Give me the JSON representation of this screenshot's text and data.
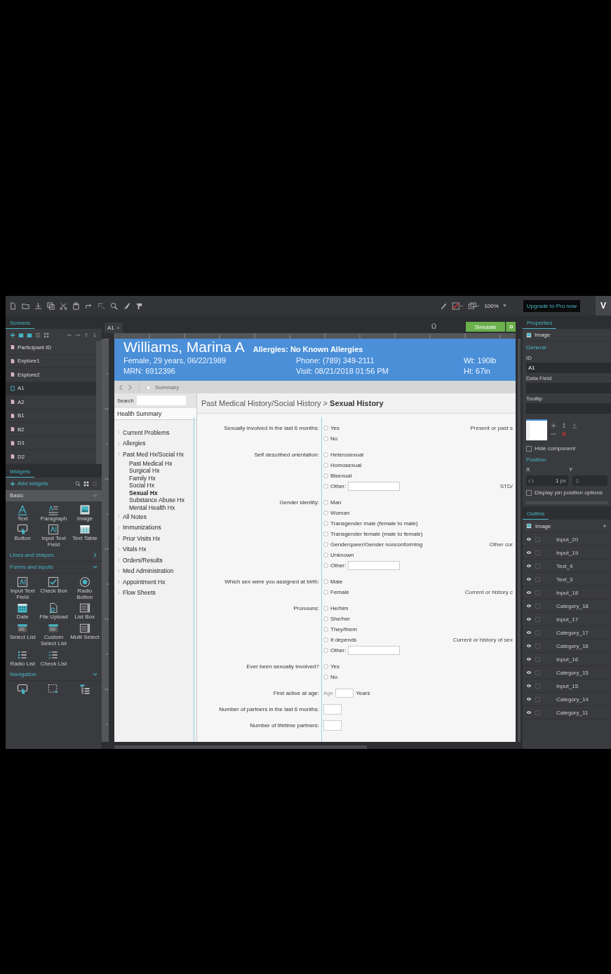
{
  "toolbar": {
    "zoom": "100%",
    "upgrade": "Upgrade to Pro now",
    "account": "V"
  },
  "screens": {
    "tab": "Screens",
    "items": [
      {
        "name": "Participant ID",
        "selected": false
      },
      {
        "name": "Explore1",
        "selected": false
      },
      {
        "name": "Explore2",
        "selected": false
      },
      {
        "name": "A1",
        "selected": true
      },
      {
        "name": "A2",
        "selected": false
      },
      {
        "name": "B1",
        "selected": false
      },
      {
        "name": "B2",
        "selected": false
      },
      {
        "name": "D1",
        "selected": false
      },
      {
        "name": "D2",
        "selected": false
      }
    ]
  },
  "widgets": {
    "tab": "Widgets",
    "add": "Add widgets",
    "sections": [
      {
        "title": "Basic",
        "kind": "bar",
        "expanded": true,
        "items": [
          {
            "label": "Text",
            "kind": "text"
          },
          {
            "label": "Paragraph",
            "kind": "paragraph"
          },
          {
            "label": "Image",
            "kind": "image"
          },
          {
            "label": "Button",
            "kind": "button"
          },
          {
            "label": "Input Text Field",
            "kind": "input"
          },
          {
            "label": "Text Table",
            "kind": "table"
          }
        ]
      },
      {
        "title": "Lines and shapes",
        "kind": "link",
        "expanded": false
      },
      {
        "title": "Forms and inputs",
        "kind": "link",
        "expanded": true,
        "items": [
          {
            "label": "Input Text Field",
            "kind": "input"
          },
          {
            "label": "Check Box",
            "kind": "checkbox"
          },
          {
            "label": "Radio Button",
            "kind": "radio"
          },
          {
            "label": "Date",
            "kind": "date"
          },
          {
            "label": "File Upload",
            "kind": "upload"
          },
          {
            "label": "List Box",
            "kind": "listbox"
          },
          {
            "label": "Select List",
            "kind": "select"
          },
          {
            "label": "Custom Select List",
            "kind": "select"
          },
          {
            "label": "Multi Select",
            "kind": "listbox"
          },
          {
            "label": "Radio List",
            "kind": "radiolist"
          },
          {
            "label": "Check List",
            "kind": "checklist"
          }
        ]
      },
      {
        "title": "Navigation",
        "kind": "link",
        "expanded": true,
        "items": [
          {
            "kind": "button"
          },
          {
            "kind": "region"
          },
          {
            "kind": "tree"
          }
        ]
      }
    ]
  },
  "canvas": {
    "tab": "A1",
    "simulate": "Simulate"
  },
  "page": {
    "header": {
      "name": "Williams, Marina A",
      "allergies": "Allergies: No Known Allergies",
      "demographics": "Female, 29 years, 06/22/1989",
      "phone": "Phone: (789) 349-2111",
      "weight": "Wt: 190lb",
      "mrn": "MRN: 6912396",
      "visit": "Visit: 08/21/2018 01:56 PM",
      "height": "Ht: 67in"
    },
    "breadcrumb": "Summary",
    "search": "Search",
    "summary": "Health Summary",
    "nav": [
      {
        "label": "Current Problems",
        "expanded": false
      },
      {
        "label": "Allergies",
        "expanded": false
      },
      {
        "label": "Past Med Hx/Social Hx",
        "expanded": true,
        "children": [
          {
            "label": "Past Medical Hx",
            "selected": false
          },
          {
            "label": "Surgical Hx",
            "selected": false
          },
          {
            "label": "Family Hx",
            "selected": false
          },
          {
            "label": "Social Hx",
            "selected": false
          },
          {
            "label": "Sexual Hx",
            "selected": true
          },
          {
            "label": "Substance Abuse Hx",
            "selected": false
          },
          {
            "label": "Mental Health Hx",
            "selected": false
          }
        ]
      },
      {
        "label": "All Notes",
        "expanded": false
      },
      {
        "label": "Immunizations",
        "expanded": false
      },
      {
        "label": "Prior Visits Hx",
        "expanded": false
      },
      {
        "label": "Vitals Hx",
        "expanded": false
      },
      {
        "label": "Orders/Results",
        "expanded": false
      },
      {
        "label": "Med Administration",
        "expanded": false
      },
      {
        "label": "Appointment Hx",
        "expanded": false
      },
      {
        "label": "Flow Sheets",
        "expanded": false
      }
    ],
    "title": "Past Medical History/Social History > **Sexual History**",
    "form": [
      {
        "kind": "radio",
        "label": "Sexually involved in the last 6 months:",
        "options": [
          {
            "label": "Yes",
            "checked": false,
            "note": "Present or past s"
          },
          {
            "label": "No",
            "checked": false
          }
        ]
      },
      {
        "kind": "radio",
        "label": "Self described orientation:",
        "options": [
          {
            "label": "Heterosexual",
            "checked": false
          },
          {
            "label": "Homosexual",
            "checked": false
          },
          {
            "label": "Bisexual",
            "checked": false
          },
          {
            "label": "Other:",
            "checked": false,
            "input": true,
            "note": "STD/"
          }
        ]
      },
      {
        "kind": "radio",
        "label": "Gender identity:",
        "options": [
          {
            "label": "Man",
            "checked": false
          },
          {
            "label": "Woman",
            "checked": false
          },
          {
            "label": "Transgender male (female to male)",
            "checked": false
          },
          {
            "label": "Transgender female (male to female)",
            "checked": false
          },
          {
            "label": "Genderqueer/Gender nonconforming",
            "checked": false,
            "note": "Other cor"
          },
          {
            "label": "Unknown",
            "checked": false
          },
          {
            "label": "Other:",
            "checked": false,
            "input": true
          }
        ]
      },
      {
        "kind": "radio",
        "label": "Which sex were you assigned at birth:",
        "options": [
          {
            "label": "Male",
            "checked": false
          },
          {
            "label": "Female",
            "checked": false,
            "note": "Current or history c"
          }
        ]
      },
      {
        "kind": "radio",
        "label": "Pronouns:",
        "options": [
          {
            "label": "He/him",
            "checked": false
          },
          {
            "label": "She/her",
            "checked": false
          },
          {
            "label": "They/them",
            "checked": false
          },
          {
            "label": "It depends",
            "checked": false,
            "note": "Current or history of sex"
          },
          {
            "label": "Other:",
            "checked": false,
            "input": true
          }
        ]
      },
      {
        "kind": "radio",
        "label": "Ever been sexually involved?",
        "options": [
          {
            "label": "Yes",
            "checked": false
          },
          {
            "label": "No",
            "checked": false
          }
        ]
      },
      {
        "kind": "age",
        "label": "First active at age:",
        "placeholder": "Age",
        "unit": "Years"
      },
      {
        "kind": "box",
        "label": "Number of partners in the last 6 months:"
      },
      {
        "kind": "box",
        "label": "Number of lifetime partners:"
      }
    ]
  },
  "properties": {
    "tab": "Properties",
    "element": "Image",
    "general": "General",
    "fields": [
      {
        "label": "ID",
        "value": "A1"
      },
      {
        "label": "Data Field"
      },
      {
        "label": "Tooltip"
      }
    ],
    "hide": {
      "label": "Hide component",
      "checked": false
    },
    "position": {
      "title": "Position",
      "x_label": "X",
      "y_label": "Y",
      "x_value": "1",
      "x_unit": "px"
    },
    "pin": {
      "label": "Display pin position options",
      "checked": false
    }
  },
  "outline": {
    "tab": "Outline",
    "root": "Image",
    "items": [
      {
        "name": "Input_20",
        "locked": false
      },
      {
        "name": "Input_19",
        "locked": false
      },
      {
        "name": "Text_4",
        "locked": false
      },
      {
        "name": "Text_3",
        "locked": false
      },
      {
        "name": "Input_18",
        "locked": false
      },
      {
        "name": "Category_18",
        "locked": false
      },
      {
        "name": "Input_17",
        "locked": false
      },
      {
        "name": "Category_17",
        "locked": false
      },
      {
        "name": "Category_16",
        "locked": false
      },
      {
        "name": "Input_16",
        "locked": false
      },
      {
        "name": "Category_15",
        "locked": false
      },
      {
        "name": "Input_15",
        "locked": false
      },
      {
        "name": "Category_14",
        "locked": false
      },
      {
        "name": "Category_11",
        "locked": false
      }
    ]
  }
}
